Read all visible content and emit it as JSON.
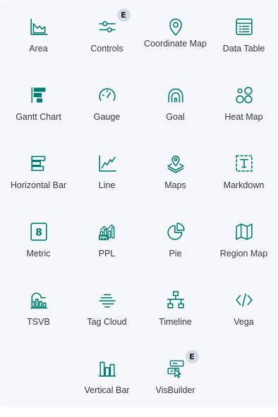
{
  "accent_color": "#017d73",
  "tiles": [
    {
      "label": "Area",
      "icon": "area-chart-icon"
    },
    {
      "label": "Controls",
      "icon": "controls-icon",
      "badge": "E"
    },
    {
      "label": "Coordinate Map",
      "icon": "map-pin-icon"
    },
    {
      "label": "Data Table",
      "icon": "table-icon"
    },
    {
      "label": "Gantt Chart",
      "icon": "gantt-icon"
    },
    {
      "label": "Gauge",
      "icon": "gauge-icon"
    },
    {
      "label": "Goal",
      "icon": "goal-icon"
    },
    {
      "label": "Heat Map",
      "icon": "heatmap-icon"
    },
    {
      "label": "Horizontal Bar",
      "icon": "horizontal-bar-icon"
    },
    {
      "label": "Line",
      "icon": "line-chart-icon"
    },
    {
      "label": "Maps",
      "icon": "maps-icon"
    },
    {
      "label": "Markdown",
      "icon": "markdown-icon"
    },
    {
      "label": "Metric",
      "icon": "metric-icon"
    },
    {
      "label": "PPL",
      "icon": "ppl-icon"
    },
    {
      "label": "Pie",
      "icon": "pie-chart-icon"
    },
    {
      "label": "Region Map",
      "icon": "region-map-icon"
    },
    {
      "label": "TSVB",
      "icon": "tsvb-icon"
    },
    {
      "label": "Tag Cloud",
      "icon": "tag-cloud-icon"
    },
    {
      "label": "Timeline",
      "icon": "timeline-icon"
    },
    {
      "label": "Vega",
      "icon": "code-icon"
    },
    {
      "label": "Vertical Bar",
      "icon": "vertical-bar-icon"
    },
    {
      "label": "VisBuilder",
      "icon": "visbuilder-icon",
      "badge": "E"
    }
  ]
}
